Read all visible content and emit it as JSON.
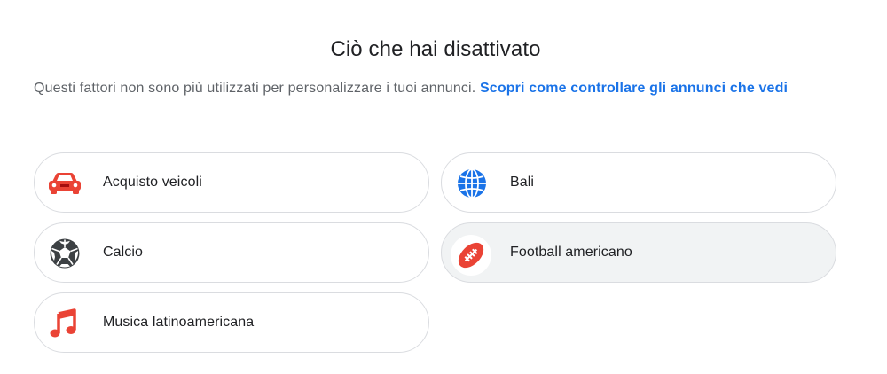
{
  "header": {
    "title": "Ciò che hai disattivato",
    "description": "Questi fattori non sono più utilizzati per personalizzare i tuoi annunci.",
    "link_text": "Scopri come controllare gli annunci che vedi"
  },
  "topics": [
    {
      "label": "Acquisto veicoli",
      "icon": "car-icon",
      "color": "#ea4335"
    },
    {
      "label": "Bali",
      "icon": "globe-icon",
      "color": "#1a73e8"
    },
    {
      "label": "Calcio",
      "icon": "soccer-ball-icon",
      "color": "#3c4043"
    },
    {
      "label": "Football americano",
      "icon": "american-football-icon",
      "color": "#ea4335",
      "highlighted": true
    },
    {
      "label": "Musica latinoamericana",
      "icon": "music-note-icon",
      "color": "#ea4335"
    }
  ],
  "colors": {
    "link": "#1a73e8",
    "text": "#202124",
    "secondary_text": "#5f6368",
    "border": "#dadce0",
    "hover_bg": "#f1f3f4"
  }
}
